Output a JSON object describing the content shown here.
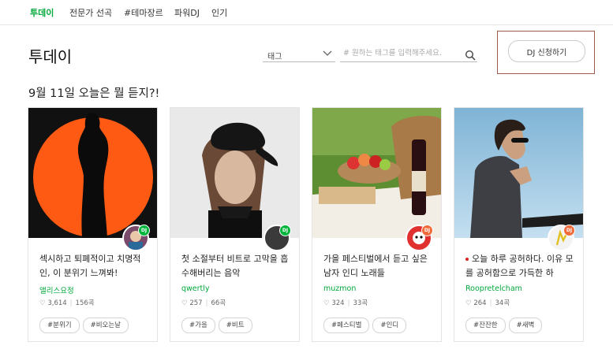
{
  "nav": {
    "tabs": [
      "투데이",
      "전문가 선곡",
      "#테마장르",
      "파워DJ",
      "인기"
    ],
    "active_color": "#00a83a"
  },
  "page": {
    "title": "투데이",
    "tag_select": "태그",
    "search_placeholder": "# 원하는 태그를 입력해주세요.",
    "dj_button": "DJ 신청하기",
    "headline": "9월 11일 오늘은 뭘 듣지?!"
  },
  "dj_badge": "DJ",
  "icons": {
    "like": "heart-icon",
    "search": "search-icon",
    "dropdown": "chevron-down-icon"
  },
  "cards": [
    {
      "title": "섹시하고 퇴폐적이고 치명적인, 이 분위기 느껴봐!",
      "author": "앨리스요정",
      "likes": "3,614",
      "songs": "156곡",
      "tags": [
        "#분위기",
        "#비오는날"
      ],
      "badge_color": "#00b53c"
    },
    {
      "title": "첫 소절부터 비트로 고막을 흡수해버리는 음악",
      "author": "qwertly",
      "likes": "257",
      "songs": "66곡",
      "tags": [
        "#가을",
        "#비트"
      ],
      "badge_color": "#00b53c"
    },
    {
      "title": "가을 페스티벌에서 듣고 싶은 남자 인디 노래들",
      "author": "muzmon",
      "likes": "324",
      "songs": "33곡",
      "tags": [
        "#페스티벌",
        "#인디"
      ],
      "badge_color": "#f06a3a"
    },
    {
      "title": "오늘 하루 공허하다. 이유 모를 공허함으로 가득한 하",
      "author": "Roopretelcham",
      "likes": "264",
      "songs": "34곡",
      "tags": [
        "#잔잔한",
        "#새벽"
      ],
      "badge_color": "#f06a3a"
    }
  ]
}
